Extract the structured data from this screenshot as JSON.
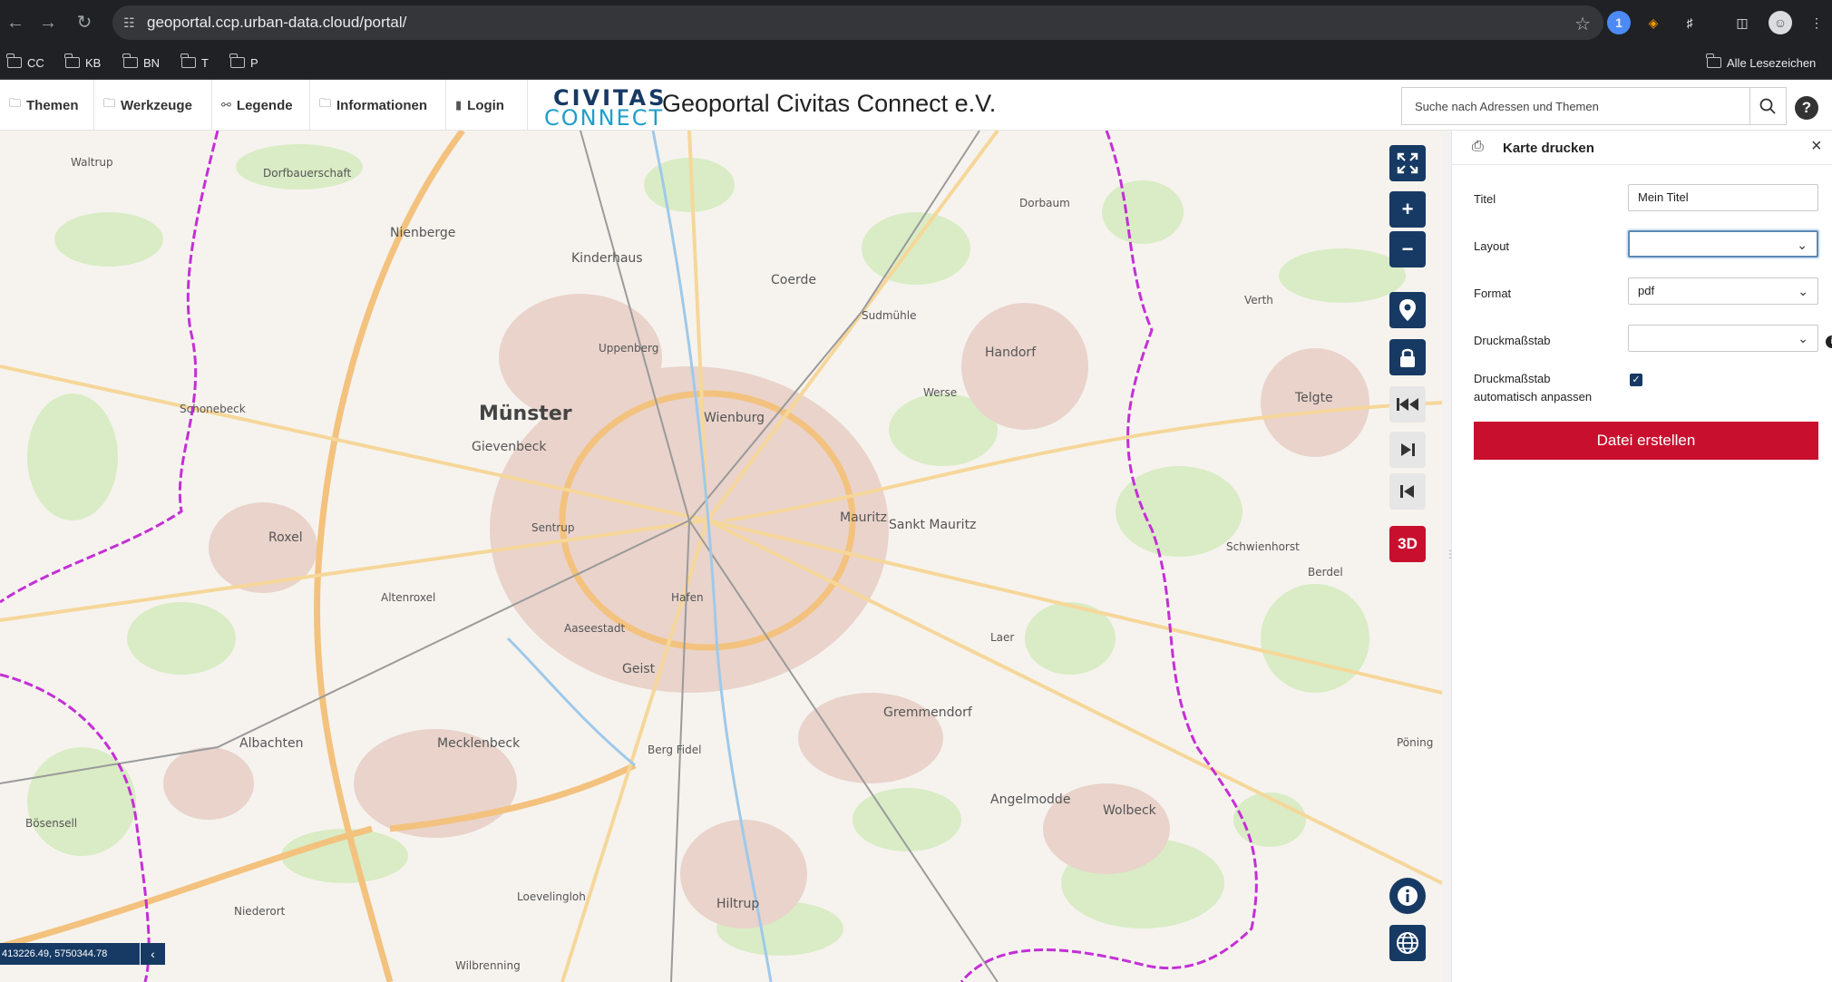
{
  "browser": {
    "url": "geoportal.ccp.urban-data.cloud/portal/",
    "bookmarks": [
      "CC",
      "KB",
      "BN",
      "T",
      "P"
    ],
    "all_bookmarks": "Alle Lesezeichen"
  },
  "header": {
    "menu": [
      {
        "label": "Themen",
        "icon": "folder-icon"
      },
      {
        "label": "Werkzeuge",
        "icon": "folder-icon"
      },
      {
        "label": "Legende",
        "icon": "lightbulb-icon"
      },
      {
        "label": "Informationen",
        "icon": "folder-icon"
      },
      {
        "label": "Login",
        "icon": "door-icon"
      }
    ],
    "logo_line1": "CIVITAS",
    "logo_line2": "CONNECT",
    "title": "Geoportal Civitas Connect e.V.",
    "search_placeholder": "Suche nach Adressen und Themen",
    "help": "?"
  },
  "map": {
    "places": [
      {
        "name": "Münster",
        "size": "big"
      },
      {
        "name": "Kinderhaus"
      },
      {
        "name": "Coerde"
      },
      {
        "name": "Nienberge"
      },
      {
        "name": "Dorfbauerschaft"
      },
      {
        "name": "Uppenberg"
      },
      {
        "name": "Sudmühle"
      },
      {
        "name": "Handorf"
      },
      {
        "name": "Dorbaum"
      },
      {
        "name": "Werse"
      },
      {
        "name": "Telgte",
        "size": "mid"
      },
      {
        "name": "Wienburg"
      },
      {
        "name": "Gievenbeck"
      },
      {
        "name": "Schonebeck"
      },
      {
        "name": "Roxel"
      },
      {
        "name": "Sentrup"
      },
      {
        "name": "Mauritz"
      },
      {
        "name": "Sankt Mauritz"
      },
      {
        "name": "Altenroxel"
      },
      {
        "name": "Aaseestadt"
      },
      {
        "name": "Hafen"
      },
      {
        "name": "Geist"
      },
      {
        "name": "Schwienhorst"
      },
      {
        "name": "Berdel"
      },
      {
        "name": "Laer"
      },
      {
        "name": "Gremmendorf"
      },
      {
        "name": "Albachten"
      },
      {
        "name": "Mecklenbeck"
      },
      {
        "name": "Berg Fidel"
      },
      {
        "name": "Angelmodde"
      },
      {
        "name": "Wolbeck"
      },
      {
        "name": "Bösensell"
      },
      {
        "name": "Loevelingloh"
      },
      {
        "name": "Hiltrup"
      },
      {
        "name": "Niederort"
      },
      {
        "name": "Wilbrenning"
      },
      {
        "name": "Waltrup"
      },
      {
        "name": "Verth"
      },
      {
        "name": "Pöning"
      }
    ],
    "controls": {
      "fullscreen": "fullscreen-icon",
      "zoom_in": "+",
      "zoom_out": "−",
      "locate": "location-pin-icon",
      "lock": "lock-icon",
      "first": "first-icon",
      "forward": "forward-icon",
      "back": "back-icon",
      "threed": "3D",
      "info": "i",
      "globe": "globe-icon"
    },
    "coordinates": "413226.49, 5750344.78",
    "colors": {
      "accent": "#173a64",
      "red": "#c8102e",
      "boundary": "#c42fd6"
    }
  },
  "print_panel": {
    "title": "Karte drucken",
    "titel_label": "Titel",
    "titel_value": "Mein Titel",
    "layout_label": "Layout",
    "layout_value": "",
    "format_label": "Format",
    "format_value": "pdf",
    "scale_label": "Druckmaßstab",
    "scale_value": "",
    "auto_label_1": "Druckmaßstab",
    "auto_label_2": "automatisch anpassen",
    "auto_checked": true,
    "create_button": "Datei erstellen"
  }
}
